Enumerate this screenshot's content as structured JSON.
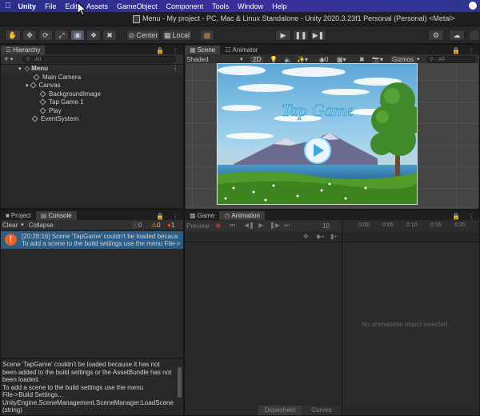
{
  "menubar": {
    "app": "Unity",
    "items": [
      "File",
      "Edit",
      "Assets",
      "GameObject",
      "Component",
      "Tools",
      "Window",
      "Help"
    ]
  },
  "titlebar": {
    "title": "Menu - My project - PC, Mac & Linux Standalone - Unity 2020.3.23f1 Personal (Personal) <Metal>"
  },
  "toolbar": {
    "center_label": "Center",
    "local_label": "Local"
  },
  "hierarchy": {
    "tab_label": "Hierarchy",
    "search_placeholder": "All",
    "items": [
      {
        "label": "Menu",
        "depth": 0
      },
      {
        "label": "Main Camera",
        "depth": 1
      },
      {
        "label": "Canvas",
        "depth": 1
      },
      {
        "label": "BackgroundImage",
        "depth": 2
      },
      {
        "label": "Tap Game 1",
        "depth": 2
      },
      {
        "label": "Play",
        "depth": 2
      },
      {
        "label": "EventSystem",
        "depth": 1
      }
    ]
  },
  "scene": {
    "tab_scene": "Scene",
    "tab_animator": "Animator",
    "shading_mode": "Shaded",
    "mode_2d": "2D",
    "gizmos_label": "Gizmos",
    "search_placeholder": "All",
    "game_title": "Tap Game",
    "colors": {
      "sky": "#6fb8de",
      "mountain": "#6b6c8e",
      "water": "#3a86b8",
      "grass": "#4f9b2c",
      "title": "#7fe0ff"
    }
  },
  "console": {
    "tab_project": "Project",
    "tab_console": "Console",
    "clear_label": "Clear",
    "collapse_label": "Collapse",
    "info_count": "0",
    "warn_count": "0",
    "error_count": "1",
    "log_line1": "[20:28:16] Scene 'TapGame' couldn't be loaded becaus",
    "log_line2": "To add a scene to the build settings use the menu File->",
    "detail": [
      "Scene 'TapGame' couldn't be loaded because it has not",
      "been added to the build settings or the AssetBundle has not",
      "been loaded.",
      "To add a scene to the build settings use the menu",
      "File->Build Settings...",
      "UnityEngine.SceneManagement.SceneManager:LoadScene",
      "(string)"
    ]
  },
  "animation": {
    "tab_game": "Game",
    "tab_animation": "Animation",
    "preview_label": "Preview",
    "frame": "10",
    "ruler": [
      "0:00",
      "0:05",
      "0:10",
      "0:15",
      "0:20",
      "0:25",
      "0:30",
      "0:35",
      "0:40",
      "0:45"
    ],
    "empty_message": "No animatable object selected.",
    "dopesheet_label": "Dopesheet",
    "curves_label": "Curves"
  }
}
